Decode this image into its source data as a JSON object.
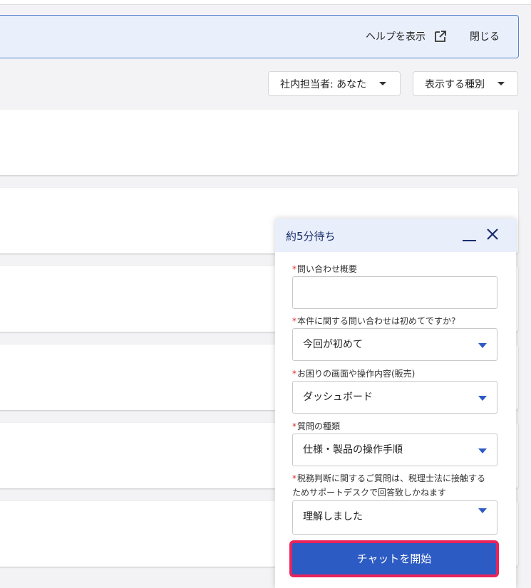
{
  "banner": {
    "help_label": "ヘルプを表示",
    "close_label": "閉じる"
  },
  "filters": {
    "assignee": "社内担当者: あなた",
    "type": "表示する種別"
  },
  "chat": {
    "title": "約5分待ち",
    "required_mark": "*",
    "fields": [
      {
        "label": "問い合わせ概要",
        "value": ""
      },
      {
        "label": "本件に関する問い合わせは初めてですか?",
        "value": "今回が初めて"
      },
      {
        "label": "お困りの画面や操作内容(販売)",
        "value": "ダッシュボード"
      },
      {
        "label": "質問の種類",
        "value": "仕様・製品の操作手順"
      },
      {
        "label_line1": "税務判断に関するご質問は、税理士法に接触する",
        "label_line2": "ためサポートデスクで回答致しかねます",
        "value": "理解しました"
      }
    ],
    "start_button": "チャットを開始"
  },
  "icons": {
    "external": "external-link-icon",
    "minimize": "minimize-icon",
    "close": "close-icon"
  }
}
